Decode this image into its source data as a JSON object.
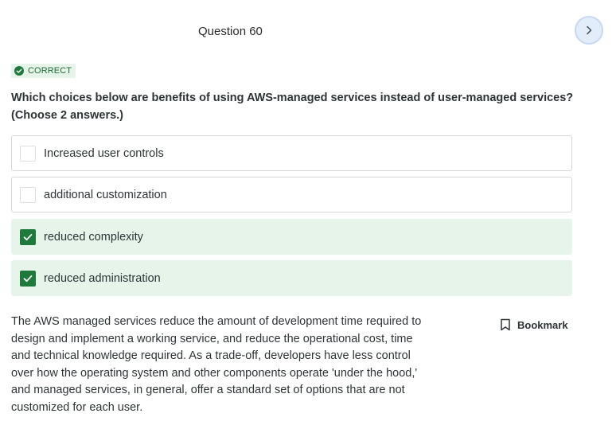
{
  "header": {
    "question_title": "Question 60",
    "next_icon": "chevron-right-icon"
  },
  "status": {
    "label": "CORRECT",
    "icon": "check-circle-icon",
    "color": "#1e7a3a"
  },
  "question": {
    "prompt": "Which choices below are benefits of using AWS-managed services instead of user-managed services? (Choose 2 answers.)",
    "choices": [
      {
        "label": "Increased user controls",
        "checked": false
      },
      {
        "label": "additional customization",
        "checked": false
      },
      {
        "label": "reduced complexity",
        "checked": true
      },
      {
        "label": "reduced administration",
        "checked": true
      }
    ]
  },
  "explanation": {
    "text": "The AWS managed services reduce the amount of development time required to design and implement a working service, and reduce the operational cost, time and technical knowledge required. As a trade-off, developers have less control over how the operating system and other components operate 'under the hood,' and managed services, in general, offer a standard set of options that are not customized for each user."
  },
  "bookmark": {
    "label": "Bookmark",
    "icon": "bookmark-icon"
  },
  "colors": {
    "accent_green": "#1e7a3a",
    "selected_bg": "#e6f4ea",
    "next_button_bg": "#e3ecf9"
  }
}
